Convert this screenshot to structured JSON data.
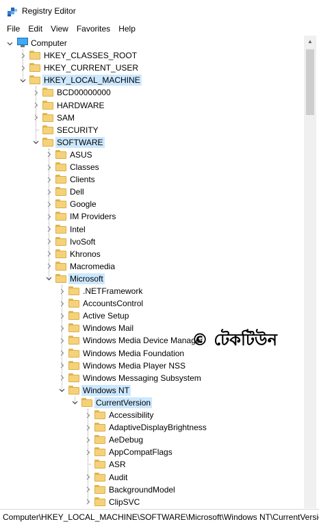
{
  "window": {
    "title": "Registry Editor",
    "icon": "registry-editor-icon"
  },
  "menu": [
    "File",
    "Edit",
    "View",
    "Favorites",
    "Help"
  ],
  "tree": [
    {
      "label": "Computer",
      "depth": 0,
      "expander": "expanded",
      "icon": "computer-icon",
      "selected": false
    },
    {
      "label": "HKEY_CLASSES_ROOT",
      "depth": 1,
      "expander": "collapsed",
      "icon": "folder-icon",
      "selected": false
    },
    {
      "label": "HKEY_CURRENT_USER",
      "depth": 1,
      "expander": "collapsed",
      "icon": "folder-icon",
      "selected": false
    },
    {
      "label": "HKEY_LOCAL_MACHINE",
      "depth": 1,
      "expander": "expanded",
      "icon": "folder-icon",
      "selected": true
    },
    {
      "label": "BCD00000000",
      "depth": 2,
      "expander": "collapsed",
      "icon": "folder-icon",
      "selected": false
    },
    {
      "label": "HARDWARE",
      "depth": 2,
      "expander": "collapsed",
      "icon": "folder-icon",
      "selected": false
    },
    {
      "label": "SAM",
      "depth": 2,
      "expander": "collapsed",
      "icon": "folder-icon",
      "selected": false
    },
    {
      "label": "SECURITY",
      "depth": 2,
      "expander": "none",
      "icon": "folder-icon",
      "selected": false
    },
    {
      "label": "SOFTWARE",
      "depth": 2,
      "expander": "expanded",
      "icon": "folder-icon",
      "selected": true
    },
    {
      "label": "ASUS",
      "depth": 3,
      "expander": "collapsed",
      "icon": "folder-icon",
      "selected": false
    },
    {
      "label": "Classes",
      "depth": 3,
      "expander": "collapsed",
      "icon": "folder-icon",
      "selected": false
    },
    {
      "label": "Clients",
      "depth": 3,
      "expander": "collapsed",
      "icon": "folder-icon",
      "selected": false
    },
    {
      "label": "Dell",
      "depth": 3,
      "expander": "collapsed",
      "icon": "folder-icon",
      "selected": false
    },
    {
      "label": "Google",
      "depth": 3,
      "expander": "collapsed",
      "icon": "folder-icon",
      "selected": false
    },
    {
      "label": "IM Providers",
      "depth": 3,
      "expander": "collapsed",
      "icon": "folder-icon",
      "selected": false
    },
    {
      "label": "Intel",
      "depth": 3,
      "expander": "collapsed",
      "icon": "folder-icon",
      "selected": false
    },
    {
      "label": "IvoSoft",
      "depth": 3,
      "expander": "collapsed",
      "icon": "folder-icon",
      "selected": false
    },
    {
      "label": "Khronos",
      "depth": 3,
      "expander": "collapsed",
      "icon": "folder-icon",
      "selected": false
    },
    {
      "label": "Macromedia",
      "depth": 3,
      "expander": "collapsed",
      "icon": "folder-icon",
      "selected": false
    },
    {
      "label": "Microsoft",
      "depth": 3,
      "expander": "expanded",
      "icon": "folder-icon",
      "selected": true
    },
    {
      "label": ".NETFramework",
      "depth": 4,
      "expander": "collapsed",
      "icon": "folder-icon",
      "selected": false
    },
    {
      "label": "AccountsControl",
      "depth": 4,
      "expander": "collapsed",
      "icon": "folder-icon",
      "selected": false
    },
    {
      "label": "Active Setup",
      "depth": 4,
      "expander": "collapsed",
      "icon": "folder-icon",
      "selected": false
    },
    {
      "label": "Windows Mail",
      "depth": 4,
      "expander": "collapsed",
      "icon": "folder-icon",
      "selected": false
    },
    {
      "label": "Windows Media Device Manager",
      "depth": 4,
      "expander": "collapsed",
      "icon": "folder-icon",
      "selected": false
    },
    {
      "label": "Windows Media Foundation",
      "depth": 4,
      "expander": "collapsed",
      "icon": "folder-icon",
      "selected": false
    },
    {
      "label": "Windows Media Player NSS",
      "depth": 4,
      "expander": "collapsed",
      "icon": "folder-icon",
      "selected": false
    },
    {
      "label": "Windows Messaging Subsystem",
      "depth": 4,
      "expander": "collapsed",
      "icon": "folder-icon",
      "selected": false
    },
    {
      "label": "Windows NT",
      "depth": 4,
      "expander": "expanded",
      "icon": "folder-icon",
      "selected": true
    },
    {
      "label": "CurrentVersion",
      "depth": 5,
      "expander": "expanded",
      "icon": "folder-icon",
      "selected": true
    },
    {
      "label": "Accessibility",
      "depth": 6,
      "expander": "collapsed",
      "icon": "folder-icon",
      "selected": false
    },
    {
      "label": "AdaptiveDisplayBrightness",
      "depth": 6,
      "expander": "collapsed",
      "icon": "folder-icon",
      "selected": false
    },
    {
      "label": "AeDebug",
      "depth": 6,
      "expander": "collapsed",
      "icon": "folder-icon",
      "selected": false
    },
    {
      "label": "AppCompatFlags",
      "depth": 6,
      "expander": "collapsed",
      "icon": "folder-icon",
      "selected": false
    },
    {
      "label": "ASR",
      "depth": 6,
      "expander": "none",
      "icon": "folder-icon",
      "selected": false
    },
    {
      "label": "Audit",
      "depth": 6,
      "expander": "collapsed",
      "icon": "folder-icon",
      "selected": false
    },
    {
      "label": "BackgroundModel",
      "depth": 6,
      "expander": "collapsed",
      "icon": "folder-icon",
      "selected": false
    },
    {
      "label": "ClipSVC",
      "depth": 6,
      "expander": "collapsed",
      "icon": "folder-icon",
      "selected": false
    }
  ],
  "statusbar": {
    "path": "Computer\\HKEY_LOCAL_MACHINE\\SOFTWARE\\Microsoft\\Windows NT\\CurrentVersion"
  },
  "watermark": {
    "text": "© টেকটিউন"
  },
  "colors": {
    "selection": "#cce8ff",
    "folder": "#f5d27a"
  }
}
